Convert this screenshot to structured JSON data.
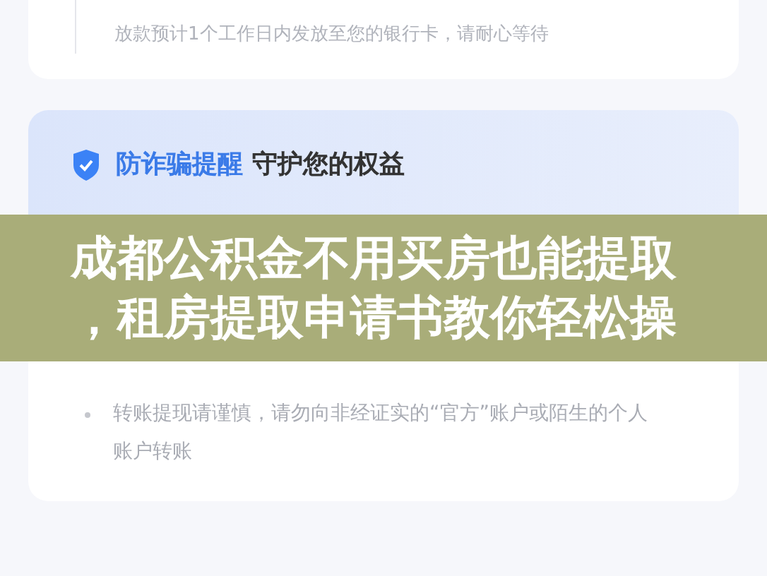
{
  "progress_card": {
    "step_note": "放款预计1个工作日内发放至您的银行卡，请耐心等待"
  },
  "safety_card": {
    "title_highlight": "防诈骗提醒",
    "title": "守护您的权益",
    "tips": [
      "转账提现请谨慎，请勿向非经证实的“官方”账户或陌生的个人账户转账"
    ]
  },
  "banner": {
    "lines": [
      "成都公积金不用买房也能提取",
      "，租房提取申请书教你轻松操"
    ]
  }
}
